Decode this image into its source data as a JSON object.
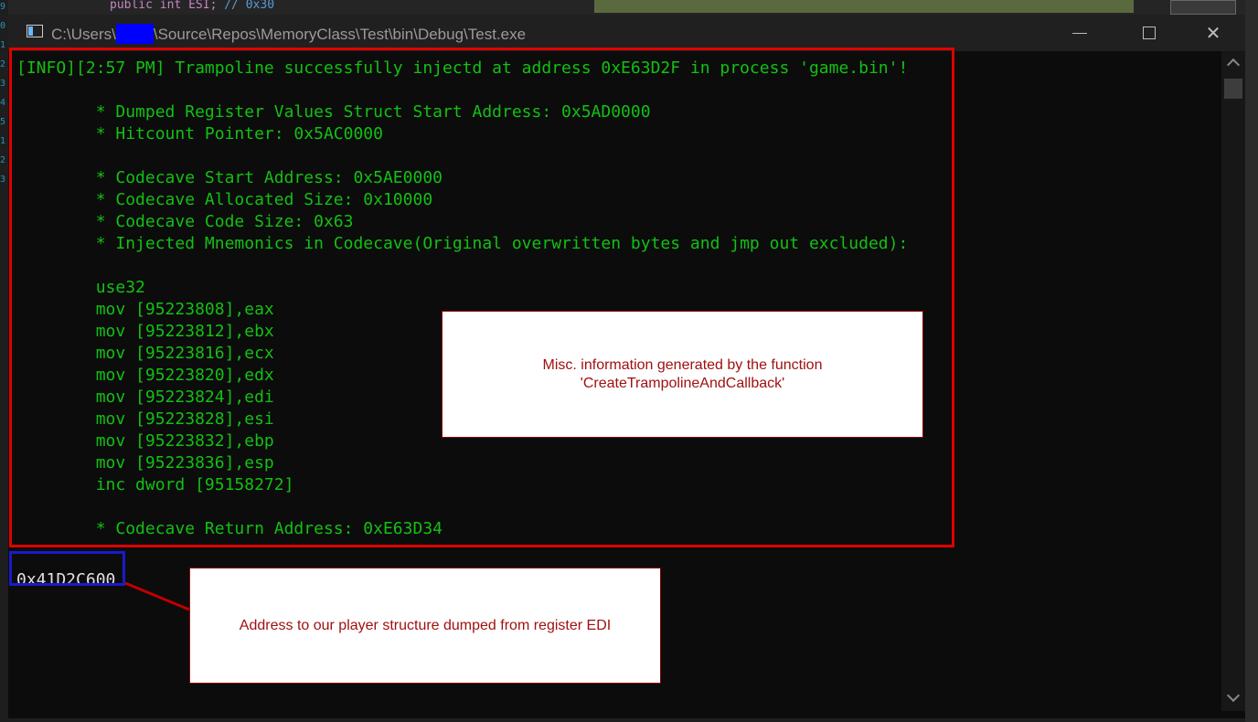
{
  "background": {
    "code_keyword": "public int ESI;",
    "code_comment": "// 0x30",
    "gutter_numbers": [
      "9",
      "0",
      "1",
      "2",
      "3",
      "4",
      "5",
      "1",
      "2",
      "3"
    ]
  },
  "window": {
    "title_prefix": "C:\\Users\\",
    "title_suffix": "\\Source\\Repos\\MemoryClass\\Test\\bin\\Debug\\Test.exe",
    "icon": "console-app-icon",
    "controls": {
      "minimize": "minimize-icon",
      "maximize": "maximize-icon",
      "close": "✕"
    }
  },
  "console": {
    "text_color": "#13c013",
    "lines": [
      "[INFO][2:57 PM] Trampoline successfully injectd at address 0xE63D2F in process 'game.bin'!",
      "",
      "        * Dumped Register Values Struct Start Address: 0x5AD0000",
      "        * Hitcount Pointer: 0x5AC0000",
      "",
      "        * Codecave Start Address: 0x5AE0000",
      "        * Codecave Allocated Size: 0x10000",
      "        * Codecave Code Size: 0x63",
      "        * Injected Mnemonics in Codecave(Original overwritten bytes and jmp out excluded):",
      "",
      "        use32",
      "        mov [95223808],eax",
      "        mov [95223812],ebx",
      "        mov [95223816],ecx",
      "        mov [95223820],edx",
      "        mov [95223824],edi",
      "        mov [95223828],esi",
      "        mov [95223832],ebp",
      "        mov [95223836],esp",
      "        inc dword [95158272]",
      "",
      "        * Codecave Return Address: 0xE63D34"
    ],
    "output_value": "0x41D2C600"
  },
  "annotations": {
    "info_callout": "Misc. information generated by the function\n'CreateTrampolineAndCallback'",
    "edi_callout": "Address to our player structure dumped from register EDI",
    "highlight_colors": {
      "red": "#e00000",
      "blue": "#1a1acc"
    }
  }
}
